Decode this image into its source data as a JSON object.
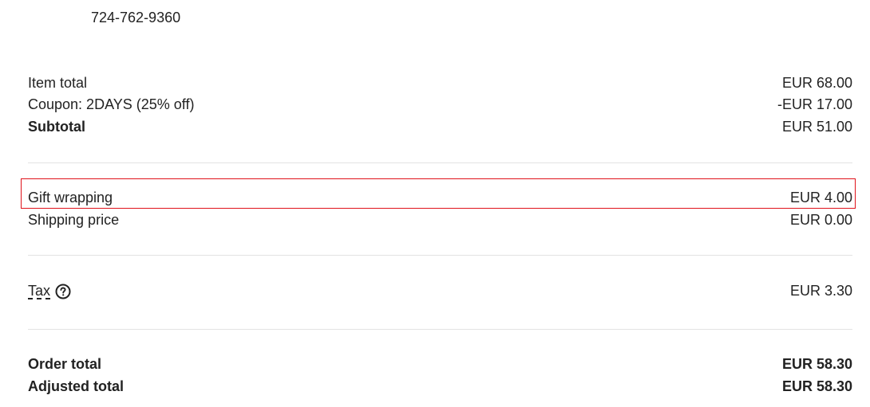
{
  "contact": {
    "phone": "724-762-9360"
  },
  "summary": {
    "item_total": {
      "label": "Item total",
      "value": "EUR 68.00"
    },
    "coupon": {
      "label": "Coupon: 2DAYS (25% off)",
      "value": "-EUR 17.00"
    },
    "subtotal": {
      "label": "Subtotal",
      "value": "EUR 51.00"
    },
    "gift_wrapping": {
      "label": "Gift wrapping",
      "value": "EUR 4.00"
    },
    "shipping": {
      "label": "Shipping price",
      "value": "EUR 0.00"
    },
    "tax": {
      "label": "Tax",
      "value": "EUR 3.30",
      "icon": "help-circle-icon"
    },
    "order_total": {
      "label": "Order total",
      "value": "EUR 58.30"
    },
    "adjusted_total": {
      "label": "Adjusted total",
      "value": "EUR 58.30"
    }
  },
  "colors": {
    "highlight": "#e0121a",
    "divider": "#e3e3e3",
    "text": "#222222"
  }
}
